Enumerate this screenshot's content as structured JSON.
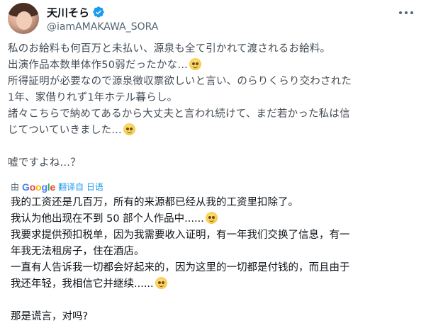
{
  "user": {
    "display_name": "天川そら",
    "handle": "@iamAMAKAWA_SORA"
  },
  "original_lines": [
    "私のお給料も何百万と未払い、源泉も全て引かれて渡されるお給料。",
    "出演作品本数単体作50弱だったかな…",
    "所得証明が必要なので源泉徴収票欲しいと言い、のらりくらり交わされた",
    "1年、家借りれず1年ホテル暮らし。",
    "諸々こちらで納めてあるから大丈夫と言われ続けて、まだ若かった私は信",
    "じてついていきました…",
    "嘘ですよね…？"
  ],
  "translate": {
    "by": "由",
    "provider": "Google",
    "action": "翻译自 日语"
  },
  "translated_lines": [
    "我的工资还是几百万，所有的来源都已经从我的工资里扣除了。",
    "我认为他出现在不到 50 部个人作品中......",
    "我要求提供预扣税单，因为我需要收入证明，有一年我们交换了信息，有一",
    "年我无法租房子，住在酒店。",
    "一直有人告诉我一切都会好起来的，因为这里的一切都是付钱的，而且由于",
    "我还年轻，我相信它并继续......",
    "那是谎言，对吗?"
  ],
  "icons": {
    "verified": "verified-badge-icon",
    "more": "more-options-icon",
    "emoji": "pleading-face-emoji"
  },
  "colors": {
    "verified": "#1d9bf0",
    "link": "#1d9bf0",
    "secondary_text": "#536471"
  }
}
